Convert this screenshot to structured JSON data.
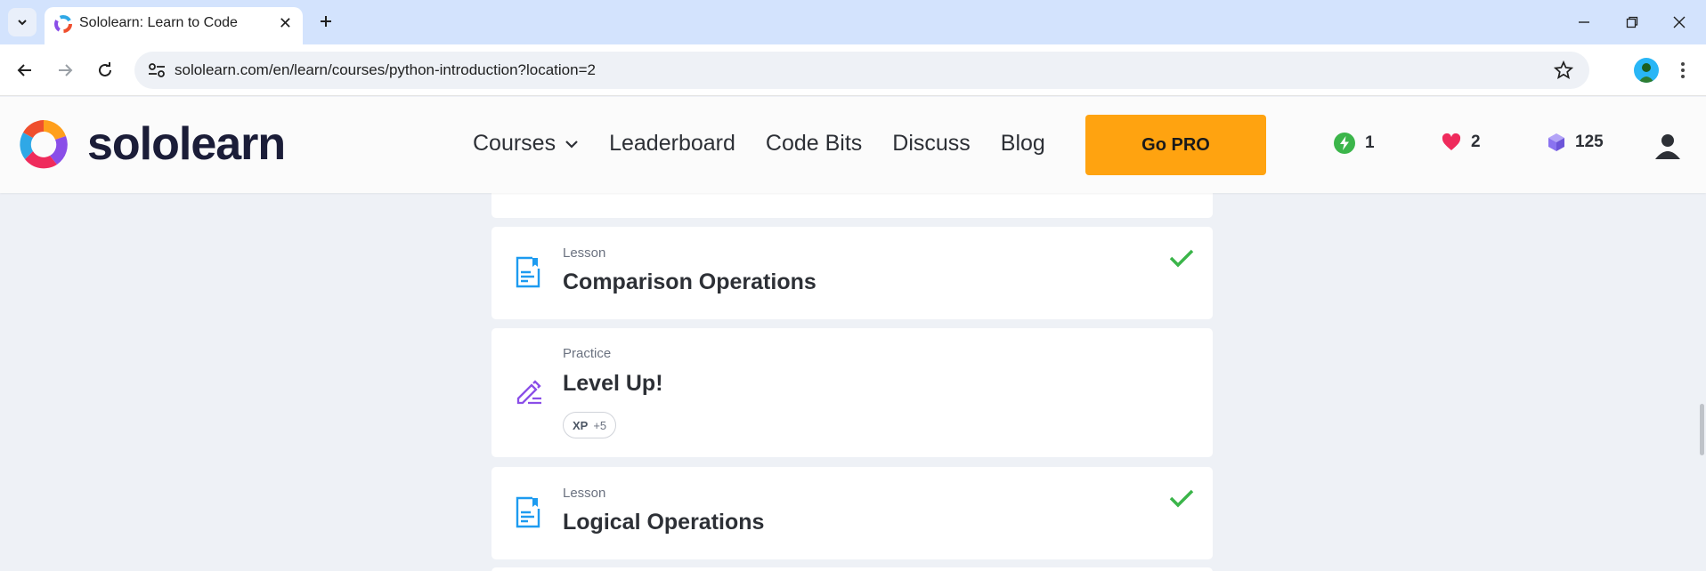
{
  "browser": {
    "tab_title": "Sololearn: Learn to Code",
    "tab_close": "✕",
    "new_tab": "+",
    "url": "sololearn.com/en/learn/courses/python-introduction?location=2"
  },
  "header": {
    "logo_text": "sololearn",
    "nav": [
      "Courses",
      "Leaderboard",
      "Code Bits",
      "Discuss",
      "Blog"
    ],
    "cta": "Go PRO",
    "streak": "1",
    "hearts": "2",
    "bits": "125",
    "colors": {
      "cta": "#ffa310",
      "streak": "#3bb54a",
      "heart": "#ef2b5c",
      "bits": "#8a73f0"
    }
  },
  "cards": [
    {
      "type": "Lesson",
      "title": "Comparison Operations",
      "completed": true,
      "icon": "lesson-icon"
    },
    {
      "type": "Practice",
      "title": "Level Up!",
      "xp_label": "XP",
      "xp_value": "+5",
      "icon": "practice-pencil-icon"
    },
    {
      "type": "Lesson",
      "title": "Logical Operations",
      "completed": true,
      "icon": "lesson-icon"
    }
  ]
}
